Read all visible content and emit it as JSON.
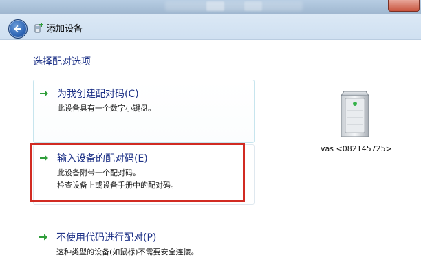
{
  "window": {
    "nav_title": "添加设备"
  },
  "main": {
    "heading": "选择配对选项",
    "options": [
      {
        "title": "为我创建配对码(C)",
        "desc": [
          "此设备具有一个数字小键盘。"
        ]
      },
      {
        "title": "输入设备的配对码(E)",
        "desc": [
          "此设备附带一个配对码。",
          "检查设备上或设备手册中的配对码。"
        ]
      },
      {
        "title": "不使用代码进行配对(P)",
        "desc": [
          "这种类型的设备(如鼠标)不需要安全连接。"
        ]
      }
    ]
  },
  "device": {
    "label": "vas <082145725>",
    "icon": "server-tower-icon"
  },
  "colors": {
    "link_blue": "#1e3287",
    "arrow_green": "#2f9e3a",
    "highlight_red": "#d12b23"
  },
  "icons": {
    "back": "back-arrow-icon",
    "app": "add-device-icon",
    "option_arrow": "green-arrow-icon"
  }
}
